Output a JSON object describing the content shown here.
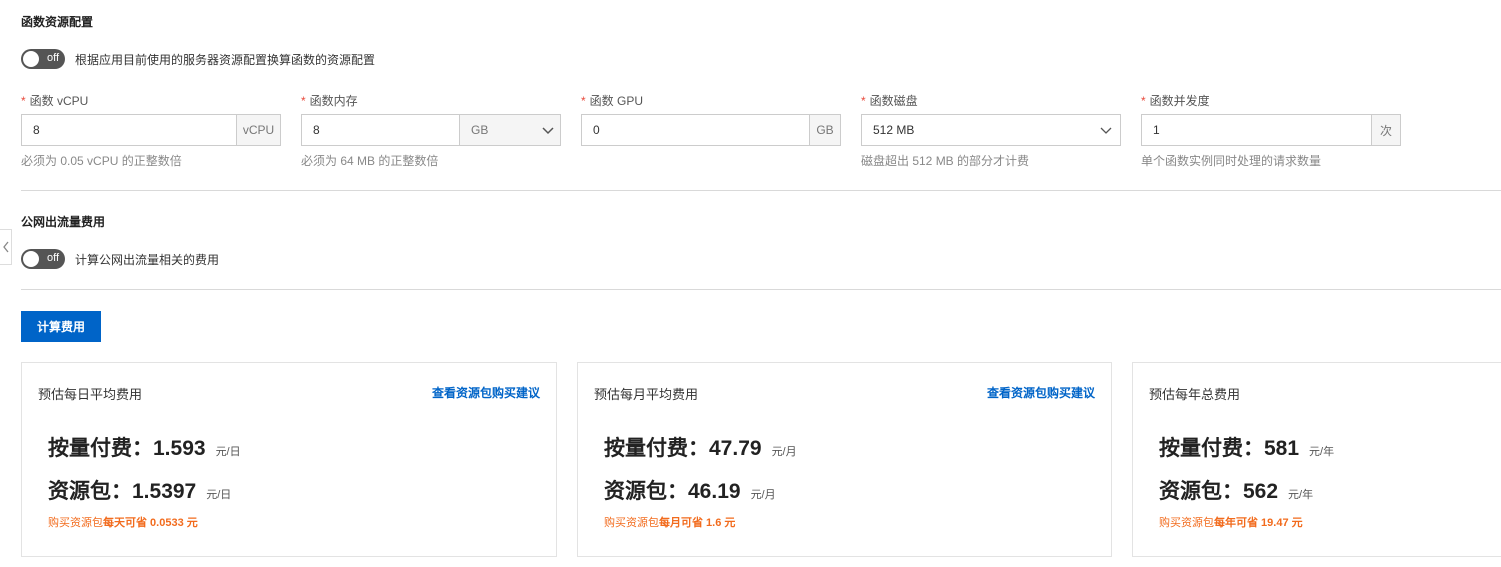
{
  "resource_section": {
    "title": "函数资源配置",
    "toggle_state": "off",
    "toggle_label": "根据应用目前使用的服务器资源配置换算函数的资源配置"
  },
  "fields": {
    "vcpu": {
      "label": "函数 vCPU",
      "value": "8",
      "unit": "vCPU",
      "help": "必须为 0.05 vCPU 的正整数倍"
    },
    "memory": {
      "label": "函数内存",
      "value": "8",
      "unit": "GB",
      "help": "必须为 64 MB 的正整数倍"
    },
    "gpu": {
      "label": "函数 GPU",
      "value": "0",
      "unit": "GB",
      "help": ""
    },
    "disk": {
      "label": "函数磁盘",
      "value": "512 MB",
      "help": "磁盘超出 512 MB 的部分才计费"
    },
    "concurrency": {
      "label": "函数并发度",
      "value": "1",
      "unit": "次",
      "help": "单个函数实例同时处理的请求数量"
    }
  },
  "required_mark": "*",
  "traffic_section": {
    "title": "公网出流量费用",
    "toggle_state": "off",
    "toggle_label": "计算公网出流量相关的费用"
  },
  "calculate_button": "计算费用",
  "cards": [
    {
      "title": "预估每日平均费用",
      "link": "查看资源包购买建议",
      "payg_label": "按量付费：",
      "payg_value": "1.593",
      "payg_unit": "元/日",
      "pkg_label": "资源包：",
      "pkg_value": "1.5397",
      "pkg_unit": "元/日",
      "save_prefix": "购买资源包",
      "save_text": "每天可省 0.0533 元"
    },
    {
      "title": "预估每月平均费用",
      "link": "查看资源包购买建议",
      "payg_label": "按量付费：",
      "payg_value": "47.79",
      "payg_unit": "元/月",
      "pkg_label": "资源包：",
      "pkg_value": "46.19",
      "pkg_unit": "元/月",
      "save_prefix": "购买资源包",
      "save_text": "每月可省 1.6 元"
    },
    {
      "title": "预估每年总费用",
      "link": "",
      "payg_label": "按量付费：",
      "payg_value": "581",
      "payg_unit": "元/年",
      "pkg_label": "资源包：",
      "pkg_value": "562",
      "pkg_unit": "元/年",
      "save_prefix": "购买资源包",
      "save_text": "每年可省 19.47 元"
    }
  ]
}
